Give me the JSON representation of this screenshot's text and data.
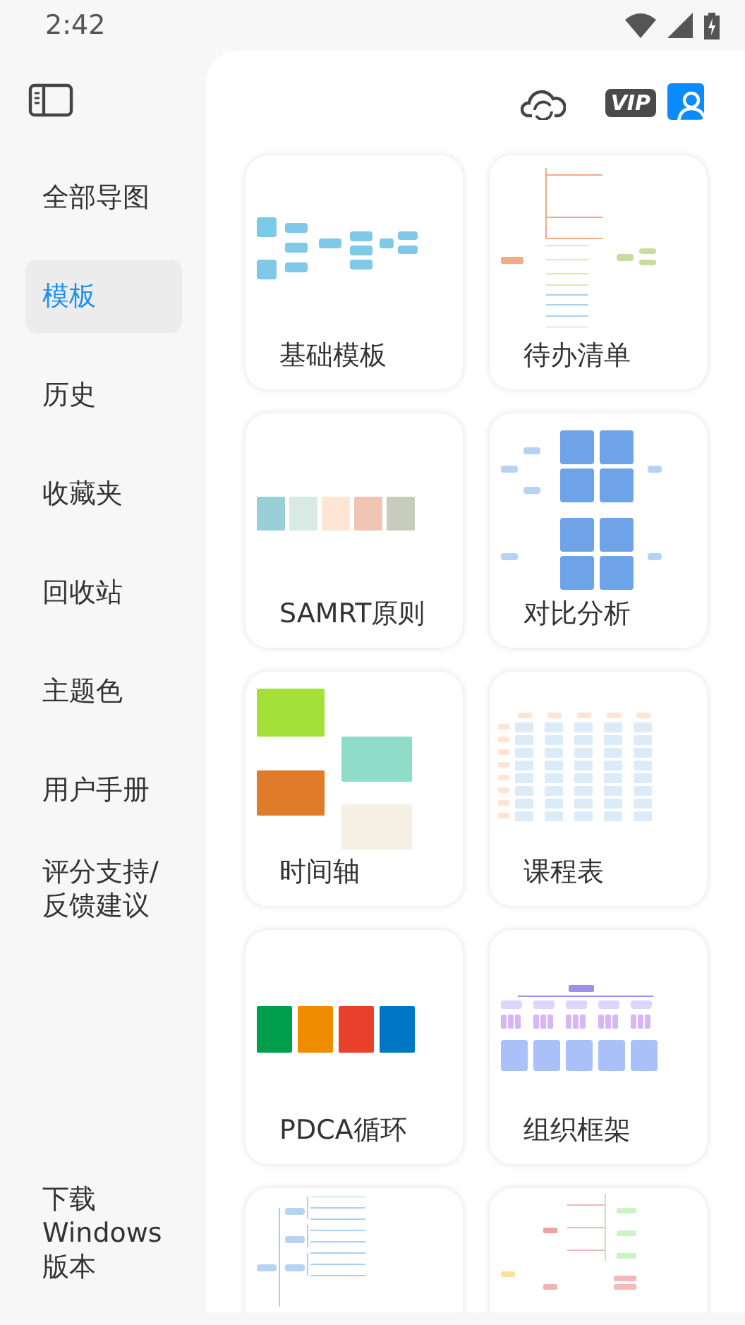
{
  "status_bar": {
    "time": "2:42"
  },
  "sidebar": {
    "items": [
      {
        "label": "全部导图",
        "selected": false
      },
      {
        "label": "模板",
        "selected": true
      },
      {
        "label": "历史",
        "selected": false
      },
      {
        "label": "收藏夹",
        "selected": false
      },
      {
        "label": "回收站",
        "selected": false
      },
      {
        "label": "主题色",
        "selected": false
      },
      {
        "label": "用户手册",
        "selected": false
      },
      {
        "label": "评分支持/反馈建议",
        "selected": false
      }
    ],
    "footer_link": "下载Windows版本"
  },
  "header": {
    "vip_badge": "VIP"
  },
  "templates": [
    {
      "label": "基础模板",
      "kind": "mindmap"
    },
    {
      "label": "待办清单",
      "kind": "todo"
    },
    {
      "label": "SAMRT原则",
      "kind": "swatches"
    },
    {
      "label": "对比分析",
      "kind": "compare"
    },
    {
      "label": "时间轴",
      "kind": "timeline"
    },
    {
      "label": "课程表",
      "kind": "table"
    },
    {
      "label": "PDCA循环",
      "kind": "pdca"
    },
    {
      "label": "组织框架",
      "kind": "org"
    },
    {
      "kind": "bluetree"
    },
    {
      "kind": "redtree"
    }
  ]
}
